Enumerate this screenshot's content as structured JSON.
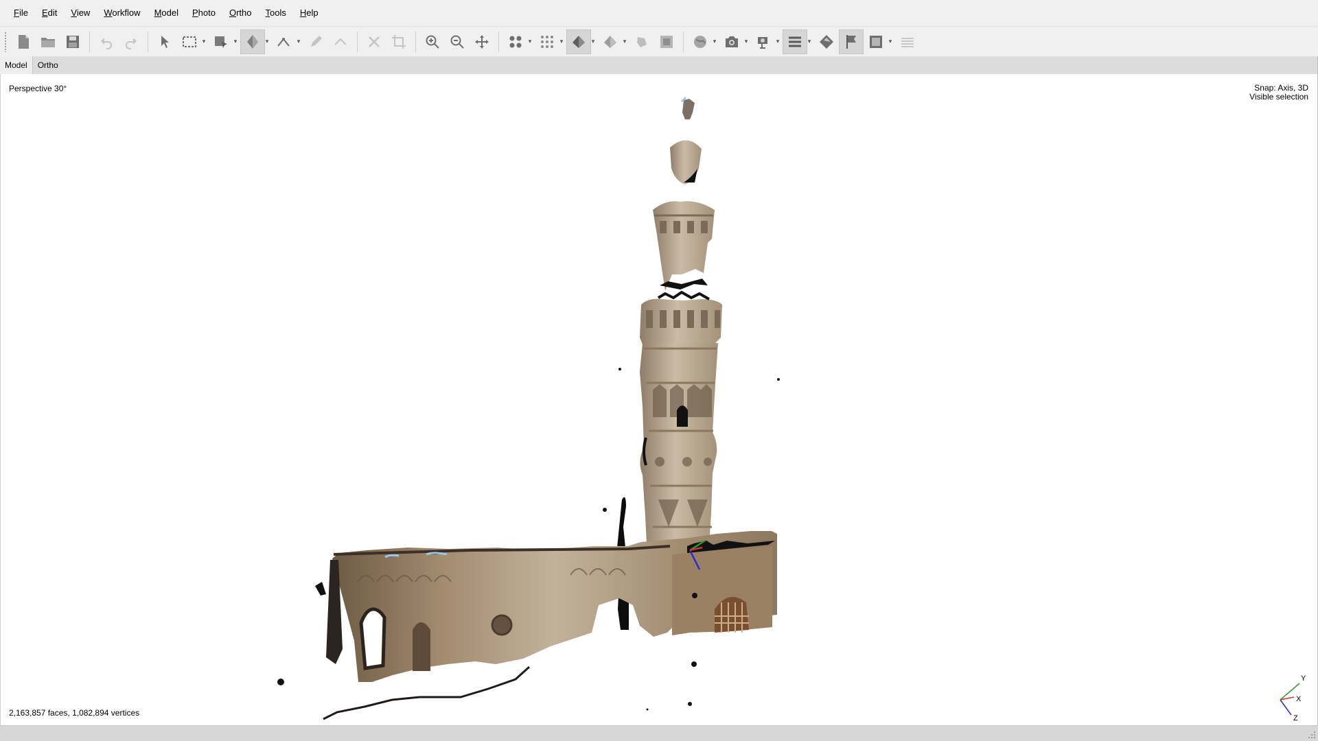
{
  "menu": [
    {
      "label": "File"
    },
    {
      "label": "Edit"
    },
    {
      "label": "View"
    },
    {
      "label": "Workflow"
    },
    {
      "label": "Model"
    },
    {
      "label": "Photo"
    },
    {
      "label": "Ortho"
    },
    {
      "label": "Tools"
    },
    {
      "label": "Help"
    }
  ],
  "toolbar": {
    "icons": [
      "new-document-icon",
      "open-folder-icon",
      "save-icon",
      "undo-icon",
      "redo-icon",
      "navigation-arrow-icon",
      "rectangle-selection-icon",
      "shape-draw-icon",
      "model-view-mode-icon",
      "ruler-icon",
      "pencil-icon",
      "polyline-icon",
      "delete-selection-icon",
      "crop-icon",
      "zoom-in-icon",
      "zoom-out-icon",
      "move-object-icon",
      "point-cloud-icon",
      "dense-cloud-icon",
      "mesh-shaded-icon",
      "mesh-solid-icon",
      "texture-icon",
      "tiled-model-icon",
      "orthomosaic-icon",
      "camera-icon",
      "region-icon",
      "layers-icon",
      "markers-icon",
      "flag-icon",
      "image-overlay-icon",
      "stack-icon"
    ]
  },
  "tabs": [
    {
      "label": "Model",
      "active": true
    },
    {
      "label": "Ortho",
      "active": false
    }
  ],
  "viewport": {
    "projection_label": "Perspective 30°",
    "snap_label": "Snap: Axis, 3D",
    "selection_label": "Visible selection",
    "stats_label": "2,163,857 faces, 1,082,894 vertices",
    "axis_labels": {
      "y": "Y",
      "x": "X",
      "z": "Z"
    }
  },
  "colors": {
    "axis_x": "#d03030",
    "axis_y": "#2a9d2a",
    "axis_z": "#2a2ad0",
    "stone": "#b7a58d"
  }
}
